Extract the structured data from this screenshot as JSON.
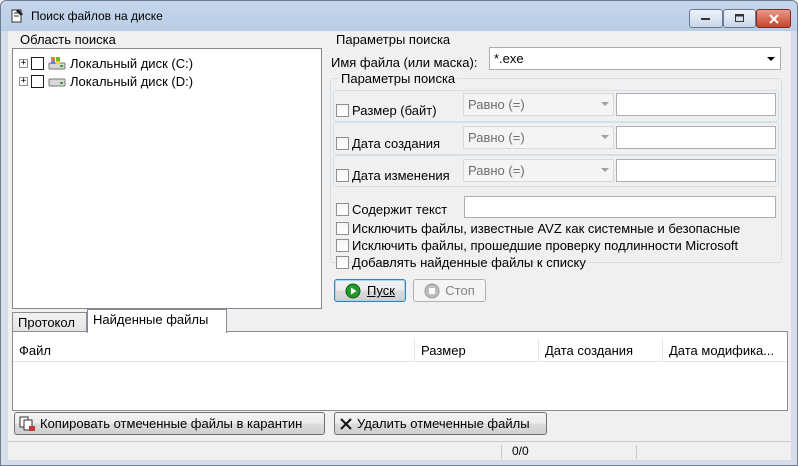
{
  "window": {
    "title": "Поиск файлов на диске"
  },
  "search_area": {
    "label": "Область поиска",
    "drives": [
      {
        "label": "Локальный диск (C:)",
        "icon": "drive-c-icon"
      },
      {
        "label": "Локальный диск (D:)",
        "icon": "drive-d-icon"
      }
    ]
  },
  "params": {
    "label": "Параметры поиска",
    "filename_label": "Имя файла (или маска):",
    "filename_value": "*.exe",
    "inner_label": "Параметры поиска",
    "size_label": "Размер (байт)",
    "size_op": "Равно (=)",
    "created_label": "Дата создания",
    "created_op": "Равно (=)",
    "modified_label": "Дата изменения",
    "modified_op": "Равно (=)",
    "contains_label": "Содержит текст",
    "exclude_system_label": "Исключить файлы, известные AVZ как системные и безопасные",
    "exclude_ms_label": "Исключить файлы, прошедшие проверку подлинности Microsoft",
    "add_to_list_label": "Добавлять найденные файлы к списку"
  },
  "buttons": {
    "start": "Пуск",
    "stop": "Стоп",
    "copy_quarantine": "Копировать отмеченные файлы в карантин",
    "delete_marked": "Удалить отмеченные файлы"
  },
  "tabs": [
    {
      "label": "Протокол",
      "active": false
    },
    {
      "label": "Найденные файлы",
      "active": true
    }
  ],
  "results_table": {
    "columns": [
      "Файл",
      "Размер",
      "Дата создания",
      "Дата модифика..."
    ],
    "rows": []
  },
  "status": {
    "counter": "0/0"
  },
  "colors": {
    "title_bar": "#b8cde6",
    "close_button": "#c8442b",
    "start_icon": "#1f9a2b"
  }
}
